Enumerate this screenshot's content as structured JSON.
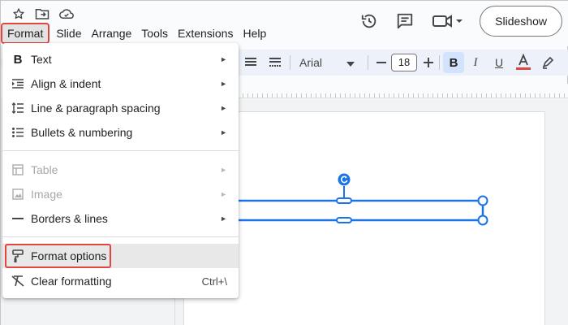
{
  "menubar": {
    "items": [
      {
        "label": "Format"
      },
      {
        "label": "Slide"
      },
      {
        "label": "Arrange"
      },
      {
        "label": "Tools"
      },
      {
        "label": "Extensions"
      },
      {
        "label": "Help"
      }
    ]
  },
  "header": {
    "slideshow_label": "Slideshow"
  },
  "toolbar": {
    "font_name": "Arial",
    "font_size": "18"
  },
  "format_menu": {
    "items": [
      {
        "label": "Text",
        "icon": "bold-b-icon",
        "submenu": true,
        "disabled": false
      },
      {
        "label": "Align & indent",
        "icon": "align-indent-icon",
        "submenu": true,
        "disabled": false
      },
      {
        "label": "Line & paragraph spacing",
        "icon": "line-spacing-icon",
        "submenu": true,
        "disabled": false
      },
      {
        "label": "Bullets & numbering",
        "icon": "bullets-icon",
        "submenu": true,
        "disabled": false
      },
      {
        "label": "Table",
        "icon": "table-icon",
        "submenu": true,
        "disabled": true
      },
      {
        "label": "Image",
        "icon": "image-icon",
        "submenu": true,
        "disabled": true
      },
      {
        "label": "Borders & lines",
        "icon": "border-line-icon",
        "submenu": true,
        "disabled": false
      },
      {
        "label": "Format options",
        "icon": "paint-roller-icon",
        "submenu": false,
        "disabled": false,
        "highlighted": true
      },
      {
        "label": "Clear formatting",
        "icon": "clear-format-icon",
        "submenu": false,
        "disabled": false,
        "shortcut": "Ctrl+\\"
      }
    ]
  },
  "colors": {
    "accent_red": "#e0463f",
    "selection_blue": "#1a73e8",
    "bold_active_bg": "#d3e3fd"
  }
}
